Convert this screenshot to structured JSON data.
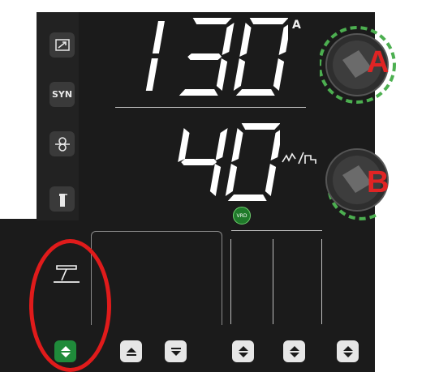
{
  "display": {
    "current_value": "130",
    "current_unit": "A",
    "secondary_value": "40",
    "vrd_label": "VRD"
  },
  "left_icons": [
    {
      "name": "arrow-ramp-icon",
      "label": ""
    },
    {
      "name": "syn-button",
      "label": "SYN"
    },
    {
      "name": "loop-icon",
      "label": ""
    },
    {
      "name": "gas-bottle-icon",
      "label": ""
    }
  ],
  "knobs": {
    "knob_a_label": "A",
    "knob_b_label": "B"
  },
  "process": {
    "selected_icon": "stick-electrode-icon"
  },
  "bottom_buttons": [
    {
      "name": "process-select-button",
      "symbol": "up-down",
      "active": true
    },
    {
      "name": "up-button",
      "symbol": "up",
      "active": false
    },
    {
      "name": "down-button",
      "symbol": "down",
      "active": false
    },
    {
      "name": "select-button-4",
      "symbol": "up-down",
      "active": false
    },
    {
      "name": "select-button-5",
      "symbol": "up-down",
      "active": false
    },
    {
      "name": "select-button-6",
      "symbol": "up-down",
      "active": false
    }
  ],
  "colors": {
    "panel": "#1b1b1b",
    "segment": "#ffffff",
    "knob_ring": "#4caf50",
    "highlight": "#e01b1b",
    "active_button": "#1f8a3a"
  }
}
